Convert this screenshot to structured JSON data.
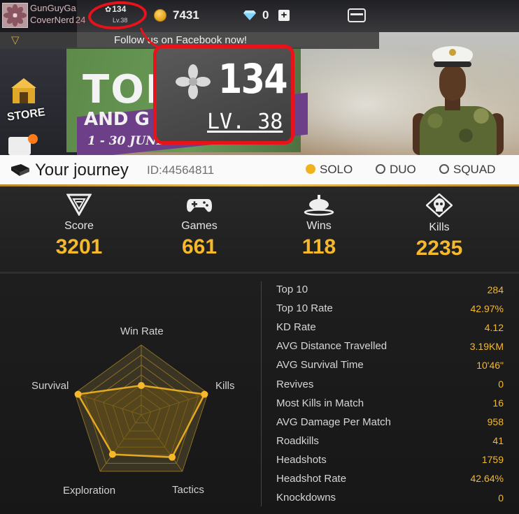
{
  "topbar": {
    "player_name_line1": "GunGuyGa",
    "player_name_line2": "CoverNerd",
    "player_name_suffix": "24",
    "rank_small": "134",
    "level_small": "Lv.38",
    "coins": "7431",
    "diamonds": "0",
    "add_label": "+"
  },
  "notice": {
    "text": "Follow us on Facebook now!"
  },
  "banner": {
    "sign_top": "TOP",
    "sign_and": "AND G",
    "sign_dates": "1 - 30 JUNE 2018"
  },
  "sidebar": {
    "store_label": "STORE"
  },
  "zoom": {
    "rank_value": "134",
    "level_label": "LV. 38"
  },
  "journey": {
    "title": "Your journey",
    "id_label": "ID:44564811",
    "modes": [
      {
        "label": "SOLO",
        "selected": true
      },
      {
        "label": "DUO",
        "selected": false
      },
      {
        "label": "SQUAD",
        "selected": false
      }
    ]
  },
  "summary": [
    {
      "icon": "score-icon",
      "label": "Score",
      "value": "3201"
    },
    {
      "icon": "gamepad-icon",
      "label": "Games",
      "value": "661"
    },
    {
      "icon": "chicken-dinner-icon",
      "label": "Wins",
      "value": "118"
    },
    {
      "icon": "skull-icon",
      "label": "Kills",
      "value": "2235"
    }
  ],
  "radar": {
    "axes": [
      "Win Rate",
      "Kills",
      "Tactics",
      "Exploration",
      "Survival"
    ],
    "levels": 7,
    "values": [
      0.42,
      0.95,
      0.75,
      0.7,
      0.95
    ]
  },
  "stats": [
    {
      "label": "Top 10",
      "value": "284"
    },
    {
      "label": "Top 10 Rate",
      "value": "42.97%"
    },
    {
      "label": "KD Rate",
      "value": "4.12"
    },
    {
      "label": "AVG Distance Travelled",
      "value": "3.19KM"
    },
    {
      "label": "AVG Survival Time",
      "value": "10'46\""
    },
    {
      "label": "Revives",
      "value": "0"
    },
    {
      "label": "Most Kills in Match",
      "value": "16"
    },
    {
      "label": "AVG Damage Per Match",
      "value": "958"
    },
    {
      "label": "Roadkills",
      "value": "41"
    },
    {
      "label": "Headshots",
      "value": "1759"
    },
    {
      "label": "Headshot Rate",
      "value": "42.64%"
    },
    {
      "label": "Knockdowns",
      "value": "0"
    }
  ],
  "colors": {
    "accent_gold": "#f5b92b",
    "annotation_red": "#e8121a",
    "radar_fill": "#6b5416"
  }
}
